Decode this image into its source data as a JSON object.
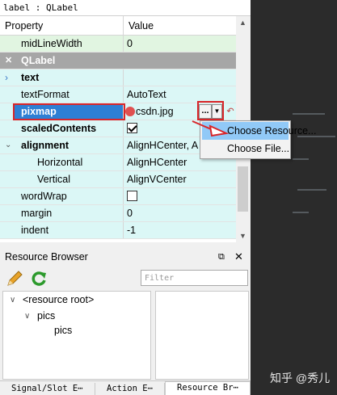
{
  "object_header": "label : QLabel",
  "columns": {
    "property": "Property",
    "value": "Value"
  },
  "rows": {
    "midline": {
      "name": "midLineWidth",
      "value": "0"
    },
    "qlabel_section": {
      "name": "QLabel"
    },
    "text": {
      "name": "text",
      "value": ""
    },
    "textformat": {
      "name": "textFormat",
      "value": "AutoText"
    },
    "pixmap": {
      "name": "pixmap",
      "value": "csdn.jpg"
    },
    "scaled": {
      "name": "scaledContents"
    },
    "alignment": {
      "name": "alignment",
      "value": "AlignHCenter, A"
    },
    "horizontal": {
      "name": "Horizontal",
      "value": "AlignHCenter"
    },
    "vertical": {
      "name": "Vertical",
      "value": "AlignVCenter"
    },
    "wordwrap": {
      "name": "wordWrap"
    },
    "margin": {
      "name": "margin",
      "value": "0"
    },
    "indent": {
      "name": "indent",
      "value": "-1"
    }
  },
  "pixmap_buttons": {
    "browse": "...",
    "dropdown": "▼"
  },
  "menu": {
    "choose_resource": "Choose Resource...",
    "choose_file": "Choose File..."
  },
  "resource_browser": {
    "title": "Resource Browser",
    "filter_placeholder": "Filter",
    "tree": {
      "root": "<resource root>",
      "folder": "pics",
      "child": "pics"
    }
  },
  "tabs": {
    "signal_slot": "Signal/Slot E⋯",
    "action": "Action E⋯",
    "resource": "Resource Br⋯"
  },
  "watermark": "知乎 @秀儿",
  "colors": {
    "cyan_row": "#dbf7f6",
    "green_row": "#e1f5e1",
    "section": "#a6a6a6",
    "selection": "#2e7fd4",
    "highlight": "#d8262a",
    "menu_hover": "#91c9f7"
  }
}
